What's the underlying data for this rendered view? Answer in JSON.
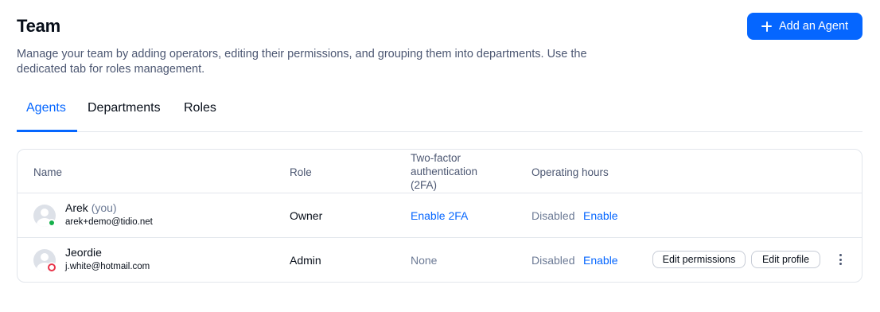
{
  "header": {
    "title": "Team",
    "description": "Manage your team by adding operators, editing their permissions, and grouping them into departments. Use the dedicated tab for roles management.",
    "add_button_label": "Add an Agent"
  },
  "tabs": [
    {
      "label": "Agents",
      "active": true
    },
    {
      "label": "Departments",
      "active": false
    },
    {
      "label": "Roles",
      "active": false
    }
  ],
  "table": {
    "columns": {
      "name": "Name",
      "role": "Role",
      "twofa_line1": "Two-factor",
      "twofa_line2": "authentication",
      "twofa_line3": "(2FA)",
      "hours": "Operating hours"
    },
    "rows": [
      {
        "name": "Arek",
        "you_label": "(you)",
        "email": "arek+demo@tidio.net",
        "status": "online",
        "role": "Owner",
        "twofa": "Enable 2FA",
        "hours_status": "Disabled",
        "hours_action": "Enable"
      },
      {
        "name": "Jeordie",
        "email": "j.white@hotmail.com",
        "status": "offline",
        "role": "Admin",
        "twofa": "None",
        "hours_status": "Disabled",
        "hours_action": "Enable",
        "edit_permissions_label": "Edit permissions",
        "edit_profile_label": "Edit profile"
      }
    ]
  },
  "icons": {
    "add": "plus-icon",
    "avatar": "user-avatar-icon",
    "more": "more-vertical-icon"
  },
  "colors": {
    "accent": "#0566ff",
    "online": "#15b04a",
    "offline": "#e8344a"
  }
}
